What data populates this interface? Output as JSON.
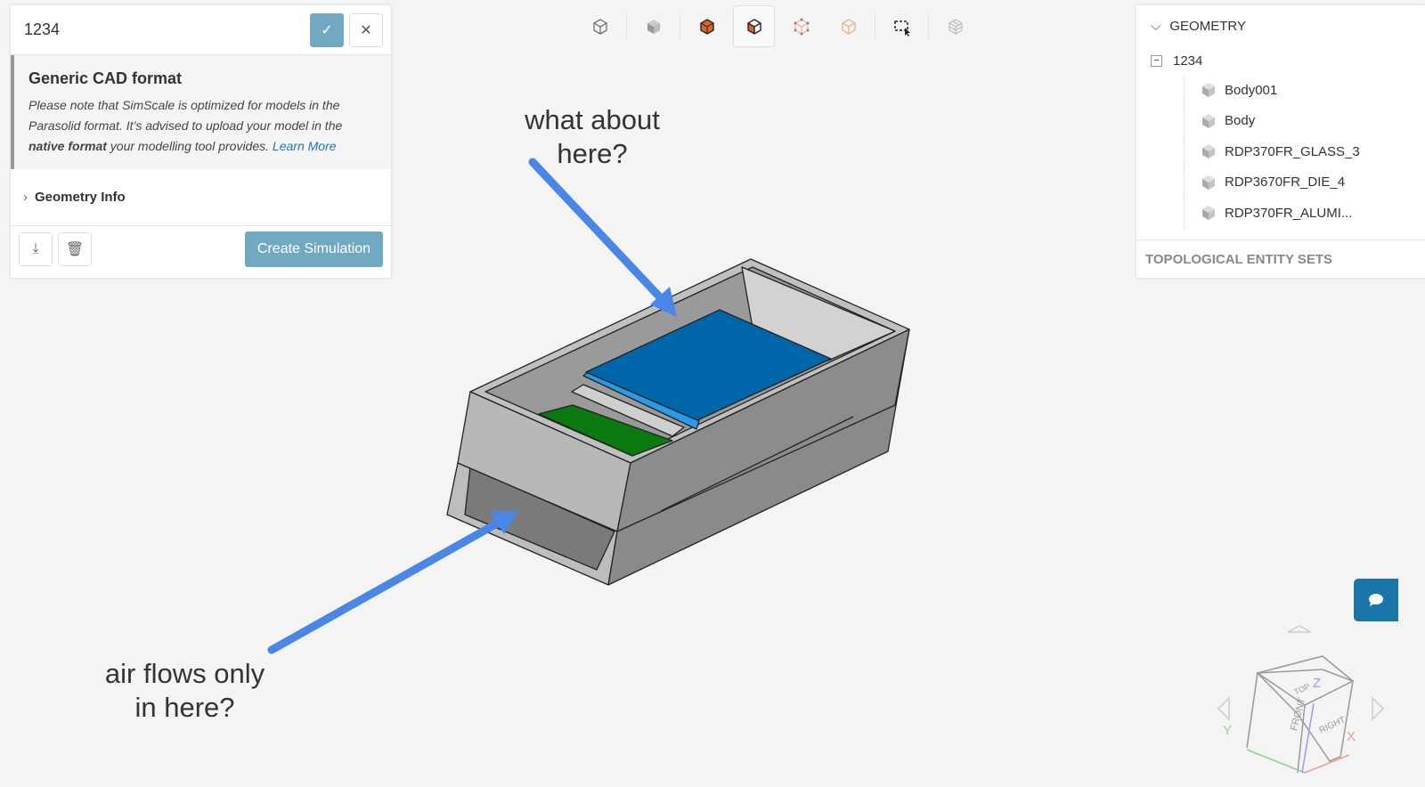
{
  "left_panel": {
    "name": "1234",
    "confirm_icon": "check-icon",
    "close_icon": "close-icon",
    "notice_title": "Generic CAD format",
    "notice_text_1": "Please note that SimScale is optimized for models in the Parasolid format. It’s advised to upload your model in the ",
    "notice_bold": "native format",
    "notice_text_2": " your modelling tool provides. ",
    "learn_more": "Learn More",
    "geometry_info": "Geometry Info",
    "create_simulation": "Create Simulation"
  },
  "right_panel": {
    "geometry_header": "GEOMETRY",
    "root": "1234",
    "bodies": [
      "Body001",
      "Body",
      "RDP370FR_GLASS_3",
      "RDP3670FR_DIE_4",
      "RDP370FR_ALUMI..."
    ],
    "topological_sets": "TOPOLOGICAL ENTITY SETS"
  },
  "annotations": {
    "top_line1": "what about",
    "top_line2": "here?",
    "bottom_line1": "air flows only",
    "bottom_line2": "in here?"
  },
  "view_cube": {
    "top": "TOP",
    "front": "FRONT",
    "right": "RIGHT",
    "x": "X",
    "y": "Y",
    "z": "Z"
  },
  "colors": {
    "accent": "#72a9c2",
    "arrow": "#4a86e8",
    "plate_blue": "#0066aa",
    "plate_green": "#0a7a10"
  }
}
